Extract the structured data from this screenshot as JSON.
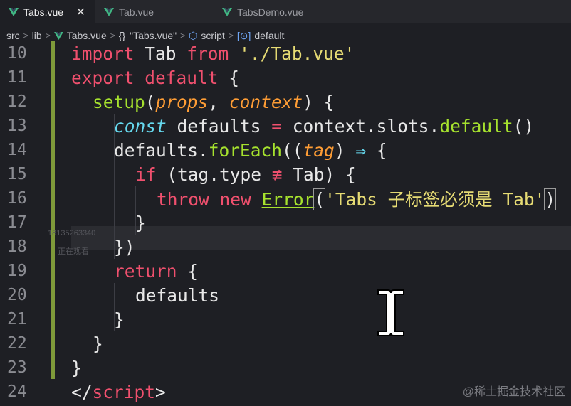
{
  "tabs": [
    {
      "label": "Tabs.vue",
      "active": true,
      "close": "✕"
    },
    {
      "label": "Tab.vue",
      "active": false
    },
    {
      "label": "TabsDemo.vue",
      "active": false
    }
  ],
  "breadcrumb": {
    "src": "src",
    "lib": "lib",
    "file": "Tabs.vue",
    "braces": "{}",
    "component": "\"Tabs.vue\"",
    "script": "script",
    "method": "default"
  },
  "editor": {
    "lines": [
      10,
      11,
      12,
      13,
      14,
      15,
      16,
      17,
      18,
      19,
      20,
      21,
      22,
      23,
      24
    ],
    "code": {
      "l10": {
        "a": "import",
        "b": " Tab ",
        "c": "from",
        "d": " ",
        "e": "'./Tab.vue'"
      },
      "l11": {
        "a": "export",
        "b": " ",
        "c": "default",
        "d": " {"
      },
      "l12": {
        "a": "setup",
        "b": "(",
        "c": "props",
        "d": ", ",
        "e": "context",
        "f": ") {"
      },
      "l13": {
        "a": "const",
        "b": " defaults ",
        "c": "=",
        "d": " context.slots.",
        "e": "default",
        "f": "()"
      },
      "l14": {
        "a": "defaults.",
        "b": "forEach",
        "c": "((",
        "d": "tag",
        "e": ") ",
        "f": "⇒",
        "g": " {"
      },
      "l15": {
        "a": "if",
        "b": " (tag.type ",
        "c": "≢",
        "d": " Tab) {"
      },
      "l16": {
        "a": "throw",
        "b": " ",
        "c": "new",
        "d": " ",
        "e": "Error",
        "f": "(",
        "g": "'Tabs 子标签必须是 Tab'",
        "h": ")"
      },
      "l17": {
        "a": "}"
      },
      "l18": {
        "a": "})"
      },
      "l19": {
        "a": "return",
        "b": " {"
      },
      "l20": {
        "a": "defaults"
      },
      "l21": {
        "a": "}"
      },
      "l22": {
        "a": "}"
      },
      "l23": {
        "a": "}"
      },
      "l24": {
        "a": "</",
        "b": "script",
        "c": ">"
      }
    }
  },
  "watermarks": {
    "phone": "18135263340",
    "watching": "正在观看",
    "site": "@稀土掘金技术社区"
  },
  "colors": {
    "keyword": "#f0506e",
    "function": "#a6e22e",
    "param": "#ff9d35",
    "string": "#e6db74",
    "type": "#66d9ef",
    "vue_icon": "#41b883"
  }
}
